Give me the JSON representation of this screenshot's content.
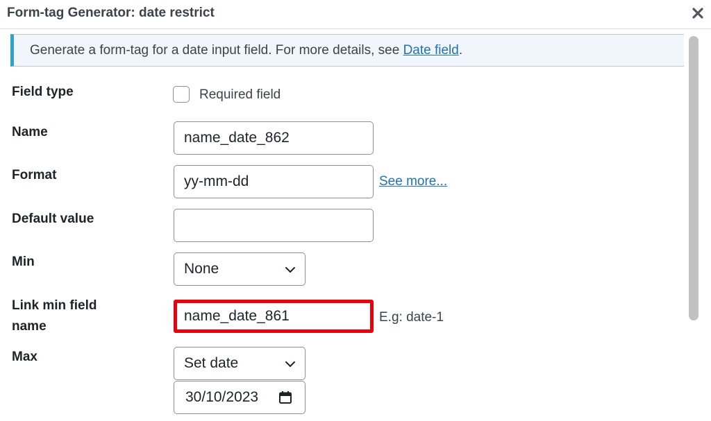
{
  "dialog": {
    "title": "Form-tag Generator: date restrict"
  },
  "notice": {
    "text": "Generate a form-tag for a date input field. For more details, see ",
    "link": "Date field",
    "suffix": "."
  },
  "fields": {
    "field_type": {
      "label": "Field type",
      "checkbox_label": "Required field",
      "checked": false
    },
    "name": {
      "label": "Name",
      "value": "name_date_862"
    },
    "format": {
      "label": "Format",
      "value": "yy-mm-dd",
      "link": "See more..."
    },
    "default_value": {
      "label": "Default value",
      "value": ""
    },
    "min": {
      "label": "Min",
      "selected": "None"
    },
    "link_min": {
      "label_line1": "Link min field",
      "label_line2": "name",
      "value": "name_date_861",
      "hint": "E.g: date-1"
    },
    "max": {
      "label": "Max",
      "selected": "Set date",
      "date_value": "30/10/2023"
    }
  },
  "colors": {
    "highlight": "#e8000d",
    "link": "#2271b1",
    "notice_border": "#2ea2cc"
  }
}
